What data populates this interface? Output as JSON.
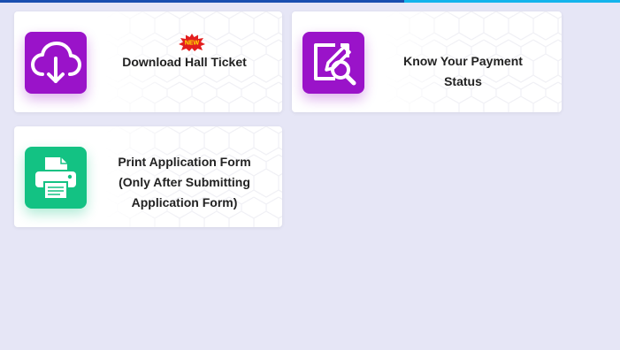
{
  "colors": {
    "page_bg": "#e6e6f6",
    "top_bar_primary": "#1a4fb0",
    "top_bar_secondary": "#14b4ec",
    "purple_tile": "#9a13c9",
    "green_tile": "#13c283",
    "badge_red": "#e31e1e",
    "badge_yellow": "#ffe600"
  },
  "cards": [
    {
      "id": "download-hall-ticket",
      "icon": "cloud-download-icon",
      "label_lines": [
        "Download Hall Ticket"
      ],
      "badge": "NEW"
    },
    {
      "id": "know-your-payment-status",
      "icon": "document-search-icon",
      "label_lines": [
        "Know Your Payment",
        "Status"
      ]
    },
    {
      "id": "print-application-form",
      "icon": "printer-icon",
      "label_lines": [
        "Print Application Form",
        "(Only After Submitting",
        "Application Form)"
      ]
    }
  ]
}
